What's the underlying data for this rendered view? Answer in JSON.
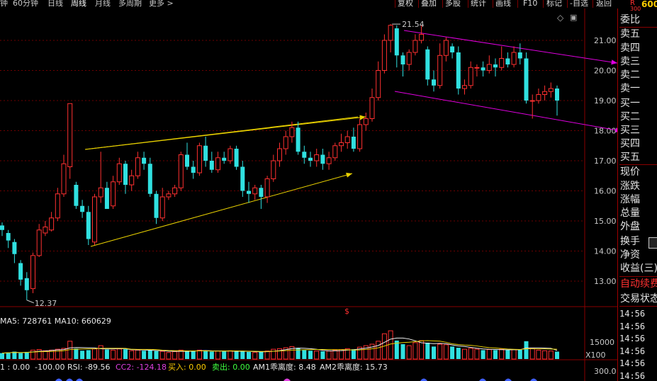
{
  "topbar": {
    "tabs": [
      "钟",
      "60分钟",
      "日线",
      "周线",
      "月线",
      "多周期",
      "更多 >"
    ],
    "active_tab": "周线",
    "buttons": [
      "复权",
      "叠加",
      "多股",
      "统计",
      "画线",
      "F10",
      "标记",
      "-自选",
      "返回"
    ],
    "icons": [
      "diamond-icon",
      "screen-icon"
    ]
  },
  "corner": {
    "code": "600",
    "flag": "R",
    "num": "300"
  },
  "price_axis": [
    "21.00",
    "20.00",
    "19.00",
    "18.00",
    "17.00",
    "16.00",
    "15.00",
    "14.00",
    "13.00"
  ],
  "annotations": {
    "high": "21.54",
    "low": "12.37",
    "dollar": "$"
  },
  "volume": {
    "ma_text": "MA5: 728761  MA10: 660629",
    "axis_top": "15000",
    "axis_unit": "X100"
  },
  "indicator": {
    "prefix": "1 : 0.00",
    "value1": "-100.00",
    "rsi": "RSI: -89.56",
    "cc2": "CC2: -124.18",
    "buy": "买入: 0.00",
    "sell": "卖出: 0.00",
    "am1": "AM1乖离度: 8.48",
    "am2": "AM2乖离度: 15.73",
    "axis": "300.0"
  },
  "panel": {
    "labels": [
      "委比",
      "卖五",
      "卖四",
      "卖三",
      "卖二",
      "卖一",
      "买一",
      "买二",
      "买三",
      "买四",
      "买五",
      "现价",
      "涨跌",
      "涨幅",
      "总量",
      "外盘",
      "换手",
      "净资",
      "收益(三)"
    ],
    "auto": "自动续费",
    "status": "交易状态",
    "times": [
      "14:56",
      "14:56",
      "14:56",
      "14:56",
      "14:56",
      "14:56"
    ]
  },
  "colors": {
    "up": "#ff3030",
    "down": "#30e0e0",
    "grid": "#6e0000",
    "trend_yellow": "#e8d000",
    "trend_magenta": "#e000e0"
  },
  "chart_data": {
    "type": "candlestick",
    "ylim": [
      12.0,
      22.0
    ],
    "candles": [
      [
        14.85,
        14.7,
        14.95,
        14.5
      ],
      [
        14.6,
        14.35,
        14.7,
        14.1
      ],
      [
        14.3,
        13.9,
        14.4,
        13.6
      ],
      [
        13.6,
        13.05,
        13.7,
        12.85
      ],
      [
        13.1,
        12.7,
        13.3,
        12.37
      ],
      [
        12.75,
        13.85,
        13.95,
        12.6
      ],
      [
        13.85,
        14.7,
        14.9,
        13.8
      ],
      [
        14.6,
        14.8,
        15.0,
        14.5
      ],
      [
        14.7,
        15.1,
        15.3,
        14.65
      ],
      [
        15.1,
        15.9,
        16.1,
        15.0
      ],
      [
        15.9,
        16.9,
        17.2,
        15.8
      ],
      [
        16.8,
        18.9,
        18.9,
        16.4
      ],
      [
        16.2,
        15.5,
        16.3,
        15.4
      ],
      [
        15.5,
        15.3,
        15.7,
        15.1
      ],
      [
        15.3,
        14.4,
        15.5,
        14.2
      ],
      [
        14.3,
        15.8,
        15.9,
        14.2
      ],
      [
        15.8,
        16.1,
        17.3,
        15.6
      ],
      [
        16.1,
        15.4,
        16.3,
        15.4
      ],
      [
        15.5,
        16.3,
        16.5,
        15.4
      ],
      [
        16.3,
        16.9,
        17.1,
        16.2
      ],
      [
        16.9,
        16.2,
        17.0,
        15.9
      ],
      [
        16.2,
        16.5,
        16.7,
        16.0
      ],
      [
        16.5,
        17.1,
        17.3,
        16.4
      ],
      [
        17.1,
        16.9,
        17.3,
        16.7
      ],
      [
        16.9,
        15.9,
        17.1,
        15.8
      ],
      [
        15.9,
        15.1,
        16.0,
        14.9
      ],
      [
        15.1,
        15.8,
        16.1,
        15.0
      ],
      [
        15.8,
        15.9,
        16.0,
        15.7
      ],
      [
        15.9,
        16.1,
        16.2,
        15.8
      ],
      [
        16.1,
        17.2,
        17.3,
        16.0
      ],
      [
        17.2,
        16.8,
        17.6,
        16.7
      ],
      [
        16.8,
        16.6,
        17.0,
        16.4
      ],
      [
        16.6,
        17.5,
        17.6,
        16.5
      ],
      [
        17.5,
        17.0,
        17.8,
        16.8
      ],
      [
        17.0,
        16.7,
        17.3,
        16.6
      ],
      [
        16.7,
        17.1,
        17.3,
        16.6
      ],
      [
        17.1,
        17.0,
        17.3,
        16.9
      ],
      [
        17.0,
        17.4,
        17.5,
        16.9
      ],
      [
        17.4,
        16.8,
        17.5,
        16.7
      ],
      [
        16.8,
        16.0,
        17.0,
        15.8
      ],
      [
        16.0,
        15.9,
        16.3,
        15.6
      ],
      [
        15.9,
        16.1,
        16.2,
        15.7
      ],
      [
        16.1,
        15.8,
        16.2,
        15.4
      ],
      [
        15.8,
        16.4,
        16.5,
        15.6
      ],
      [
        16.4,
        17.0,
        17.2,
        16.3
      ],
      [
        17.0,
        17.4,
        17.6,
        16.8
      ],
      [
        17.4,
        17.8,
        18.0,
        17.2
      ],
      [
        17.8,
        18.1,
        18.3,
        17.6
      ],
      [
        18.1,
        17.3,
        18.3,
        17.2
      ],
      [
        17.3,
        17.1,
        17.5,
        16.9
      ],
      [
        17.1,
        17.0,
        17.3,
        16.8
      ],
      [
        17.0,
        17.2,
        17.4,
        16.8
      ],
      [
        17.2,
        16.9,
        17.4,
        16.7
      ],
      [
        16.9,
        17.1,
        17.3,
        16.7
      ],
      [
        17.1,
        17.5,
        17.6,
        17.0
      ],
      [
        17.5,
        17.6,
        17.9,
        17.3
      ],
      [
        17.6,
        17.8,
        18.0,
        17.4
      ],
      [
        17.8,
        17.4,
        18.1,
        17.3
      ],
      [
        17.4,
        18.2,
        18.4,
        17.3
      ],
      [
        18.2,
        18.4,
        18.6,
        18.0
      ],
      [
        18.4,
        19.1,
        19.4,
        18.3
      ],
      [
        19.1,
        20.0,
        20.3,
        19.0
      ],
      [
        20.0,
        21.0,
        21.2,
        19.9
      ],
      [
        21.0,
        21.5,
        21.54,
        20.6
      ],
      [
        21.4,
        20.5,
        21.5,
        20.1
      ],
      [
        20.5,
        20.2,
        20.6,
        19.8
      ],
      [
        20.2,
        20.6,
        20.7,
        20.0
      ],
      [
        20.6,
        21.0,
        21.2,
        20.5
      ],
      [
        21.0,
        21.2,
        21.5,
        20.9
      ],
      [
        20.7,
        19.7,
        20.8,
        19.5
      ],
      [
        19.7,
        19.5,
        20.0,
        19.3
      ],
      [
        19.5,
        20.5,
        20.9,
        19.4
      ],
      [
        20.5,
        21.0,
        21.1,
        20.3
      ],
      [
        20.8,
        20.6,
        20.9,
        20.4
      ],
      [
        20.6,
        19.4,
        20.8,
        19.2
      ],
      [
        19.4,
        19.5,
        19.7,
        19.2
      ],
      [
        19.5,
        20.1,
        20.3,
        19.4
      ],
      [
        20.1,
        20.1,
        20.2,
        19.8
      ],
      [
        20.1,
        20.0,
        20.3,
        19.8
      ],
      [
        20.0,
        20.2,
        20.5,
        19.9
      ],
      [
        20.2,
        20.1,
        20.4,
        19.8
      ],
      [
        20.1,
        20.4,
        20.8,
        20.0
      ],
      [
        20.4,
        20.2,
        20.6,
        20.1
      ],
      [
        20.2,
        20.6,
        20.8,
        20.1
      ],
      [
        20.6,
        20.4,
        20.9,
        20.2
      ],
      [
        20.4,
        19.0,
        20.6,
        18.9
      ],
      [
        19.0,
        19.0,
        19.2,
        18.4
      ],
      [
        19.0,
        19.2,
        19.4,
        18.9
      ],
      [
        19.2,
        19.3,
        19.5,
        19.0
      ],
      [
        19.3,
        19.4,
        19.6,
        19.1
      ],
      [
        19.4,
        19.0,
        19.5,
        18.5
      ]
    ],
    "volumes": [
      0.2,
      0.22,
      0.25,
      0.2,
      0.24,
      0.3,
      0.32,
      0.28,
      0.3,
      0.33,
      0.36,
      0.6,
      0.35,
      0.28,
      0.3,
      0.34,
      0.45,
      0.32,
      0.3,
      0.34,
      0.33,
      0.28,
      0.3,
      0.28,
      0.3,
      0.27,
      0.26,
      0.22,
      0.25,
      0.3,
      0.28,
      0.27,
      0.3,
      0.28,
      0.25,
      0.27,
      0.26,
      0.28,
      0.25,
      0.26,
      0.24,
      0.22,
      0.25,
      0.27,
      0.33,
      0.35,
      0.38,
      0.42,
      0.36,
      0.3,
      0.28,
      0.27,
      0.26,
      0.27,
      0.3,
      0.32,
      0.35,
      0.33,
      0.4,
      0.45,
      0.5,
      0.6,
      0.85,
      0.95,
      0.62,
      0.5,
      0.45,
      0.55,
      0.62,
      0.55,
      0.42,
      0.5,
      0.48,
      0.42,
      0.38,
      0.33,
      0.36,
      0.33,
      0.3,
      0.32,
      0.3,
      0.33,
      0.3,
      0.32,
      0.31,
      0.6,
      0.35,
      0.3,
      0.28,
      0.27,
      0.25
    ]
  }
}
